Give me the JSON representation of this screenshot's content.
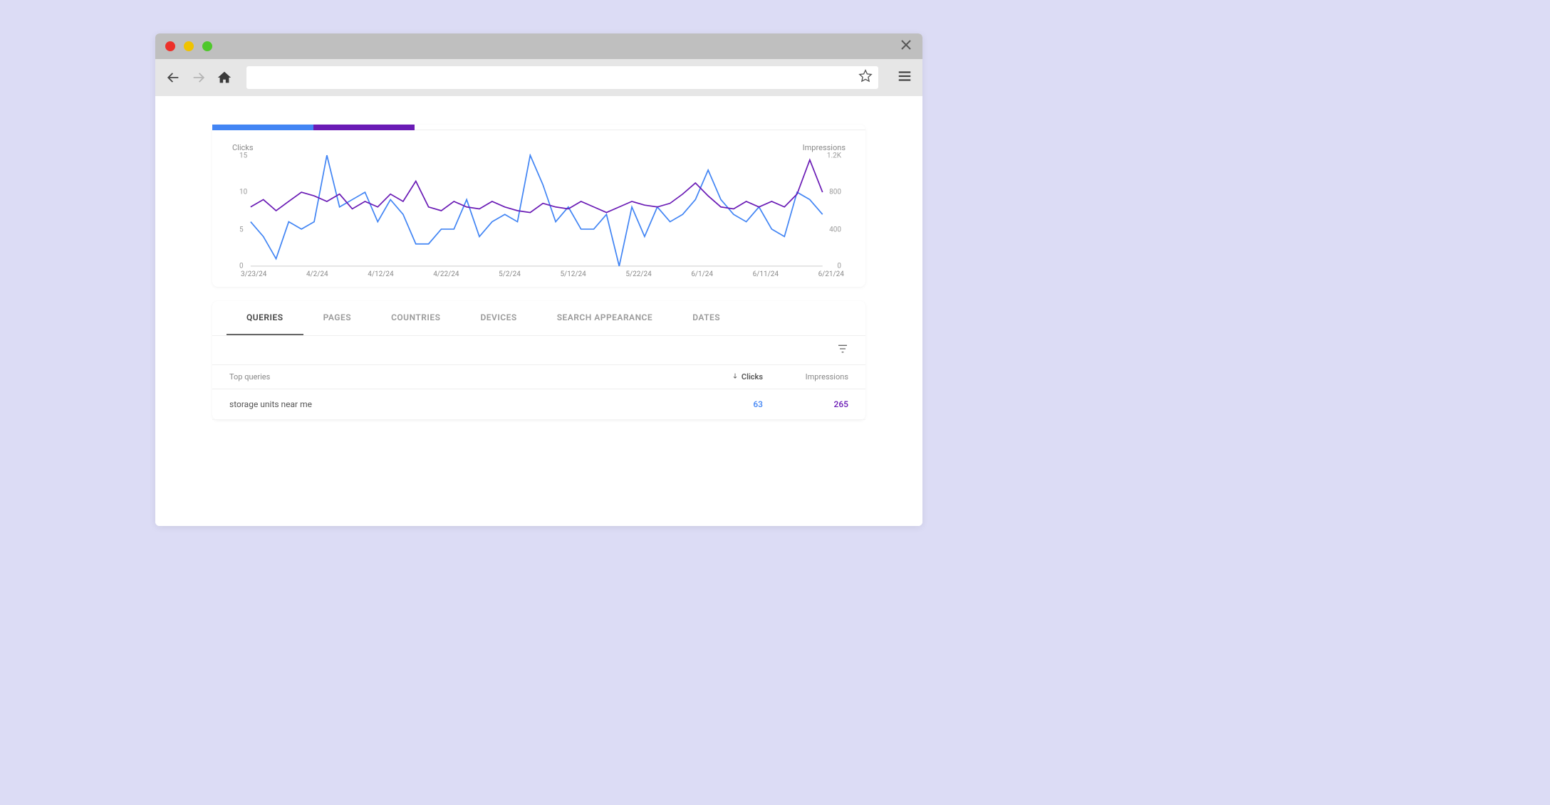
{
  "browser": {
    "url": ""
  },
  "chart": {
    "left_label": "Clicks",
    "right_label": "Impressions",
    "y_left_ticks": [
      "15",
      "10",
      "5",
      "0"
    ],
    "y_right_ticks": [
      "1.2K",
      "800",
      "400",
      "0"
    ],
    "x_ticks": [
      "3/23/24",
      "4/2/24",
      "4/12/24",
      "4/22/24",
      "5/2/24",
      "5/12/24",
      "5/22/24",
      "6/1/24",
      "6/11/24",
      "6/21/24"
    ]
  },
  "tabs": [
    "QUERIES",
    "PAGES",
    "COUNTRIES",
    "DEVICES",
    "SEARCH APPEARANCE",
    "DATES"
  ],
  "table": {
    "header_query": "Top queries",
    "header_clicks": "Clicks",
    "header_impressions": "Impressions",
    "rows": [
      {
        "query": "storage units near me",
        "clicks": "63",
        "impressions": "265"
      }
    ]
  },
  "colors": {
    "clicks": "#4285f4",
    "impressions": "#6a1bb5"
  },
  "chart_data": {
    "type": "line",
    "x": [
      "3/23/24",
      "3/25/24",
      "3/27/24",
      "3/29/24",
      "3/31/24",
      "4/2/24",
      "4/4/24",
      "4/6/24",
      "4/8/24",
      "4/10/24",
      "4/12/24",
      "4/14/24",
      "4/16/24",
      "4/18/24",
      "4/20/24",
      "4/22/24",
      "4/24/24",
      "4/26/24",
      "4/28/24",
      "4/30/24",
      "5/2/24",
      "5/4/24",
      "5/6/24",
      "5/8/24",
      "5/10/24",
      "5/12/24",
      "5/14/24",
      "5/16/24",
      "5/18/24",
      "5/20/24",
      "5/22/24",
      "5/24/24",
      "5/26/24",
      "5/28/24",
      "5/30/24",
      "6/1/24",
      "6/3/24",
      "6/5/24",
      "6/7/24",
      "6/9/24",
      "6/11/24",
      "6/13/24",
      "6/15/24",
      "6/17/24",
      "6/19/24",
      "6/21/24"
    ],
    "series": [
      {
        "name": "Clicks",
        "axis": "left",
        "color": "#4285f4",
        "values": [
          6,
          4,
          1,
          6,
          5,
          6,
          15,
          8,
          9,
          10,
          6,
          9,
          7,
          3,
          3,
          5,
          5,
          9,
          4,
          6,
          7,
          6,
          15,
          11,
          6,
          8,
          5,
          5,
          7,
          0,
          8,
          4,
          8,
          6,
          7,
          9,
          13,
          9,
          7,
          6,
          8,
          5,
          4,
          10,
          9,
          7
        ]
      },
      {
        "name": "Impressions",
        "axis": "right",
        "color": "#6a1bb5",
        "values": [
          640,
          720,
          600,
          700,
          800,
          760,
          700,
          780,
          620,
          700,
          640,
          780,
          700,
          920,
          640,
          600,
          700,
          640,
          620,
          700,
          640,
          600,
          580,
          680,
          640,
          620,
          700,
          640,
          580,
          640,
          700,
          660,
          640,
          680,
          780,
          900,
          760,
          640,
          620,
          700,
          640,
          700,
          640,
          780,
          1150,
          800
        ]
      }
    ],
    "ylim_left": [
      0,
      15
    ],
    "ylim_right": [
      0,
      1200
    ],
    "xlabel": "",
    "ylabel_left": "Clicks",
    "ylabel_right": "Impressions"
  }
}
